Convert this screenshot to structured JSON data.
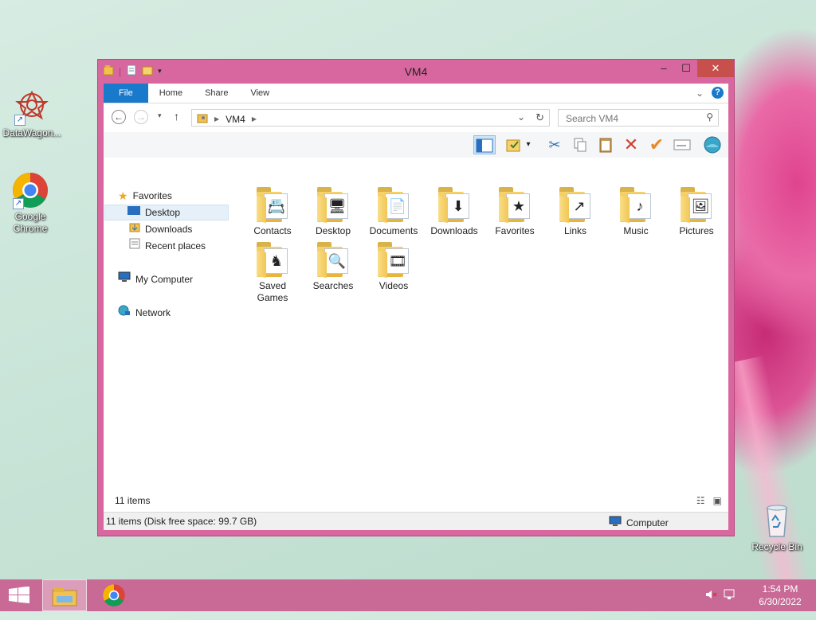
{
  "desktop": {
    "icons": [
      {
        "label": "DataWagon..."
      },
      {
        "label": "Google Chrome"
      },
      {
        "label": "Recycle Bin"
      }
    ]
  },
  "window": {
    "title": "VM4",
    "minimize": "–",
    "maximize": "☐",
    "close": "✕"
  },
  "ribbon": {
    "tabs": [
      "File",
      "Home",
      "Share",
      "View"
    ],
    "help": "?",
    "collapse": "⌄"
  },
  "address": {
    "location": "VM4",
    "search_placeholder": "Search VM4"
  },
  "sidebar": {
    "favorites": "Favorites",
    "desktop": "Desktop",
    "downloads": "Downloads",
    "recent": "Recent places",
    "computer": "My Computer",
    "network": "Network"
  },
  "folders": [
    {
      "label": "Contacts",
      "icon": "contacts-icon",
      "emb": "📇"
    },
    {
      "label": "Desktop",
      "icon": "desktop-icon",
      "emb": "🖥"
    },
    {
      "label": "Documents",
      "icon": "documents-icon",
      "emb": "📄"
    },
    {
      "label": "Downloads",
      "icon": "downloads-icon",
      "emb": "⬇"
    },
    {
      "label": "Favorites",
      "icon": "favorites-icon",
      "emb": "★"
    },
    {
      "label": "Links",
      "icon": "links-icon",
      "emb": "↗"
    },
    {
      "label": "Music",
      "icon": "music-icon",
      "emb": "♪"
    },
    {
      "label": "Pictures",
      "icon": "pictures-icon",
      "emb": "🖼"
    },
    {
      "label": "Saved Games",
      "icon": "saved-games-icon",
      "emb": "♞"
    },
    {
      "label": "Searches",
      "icon": "searches-icon",
      "emb": "🔍"
    },
    {
      "label": "Videos",
      "icon": "videos-icon",
      "emb": "🎞"
    }
  ],
  "status": {
    "item_count": "11 items",
    "bar_left": "11 items (Disk free space: 99.7 GB)",
    "bar_right": "Computer"
  },
  "taskbar": {
    "time": "1:54 PM",
    "date": "6/30/2022"
  },
  "colors": {
    "accent": "#1979ca",
    "window_frame": "#d9679f",
    "taskbar": "#c86996",
    "close_button": "#c7504c"
  }
}
